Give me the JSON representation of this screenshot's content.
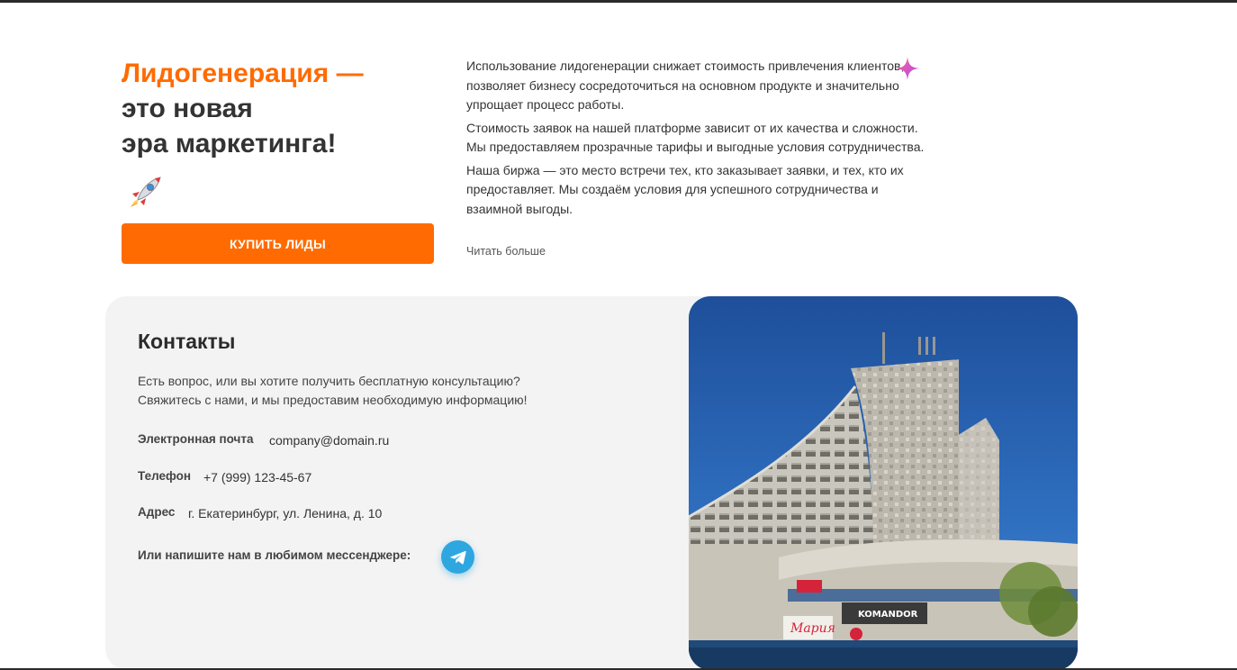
{
  "hero": {
    "title_accent": "Лидогенерация —",
    "title_line2": "это новая",
    "title_line3": "эра маркетинга!",
    "rocket_icon": "rocket-icon",
    "buy_button": "КУПИТЬ ЛИДЫ",
    "paragraphs": [
      "Использование лидогенерации снижает стоимость привлечения клиентов, позволяет бизнесу сосредоточиться на основном продукте и значительно упрощает процесс работы.",
      "Стоимость заявок на нашей платформе зависит от их качества и сложности. Мы предоставляем прозрачные тарифы и выгодные условия сотрудничества.",
      "Наша биржа — это место встречи тех, кто заказывает заявки, и тех, кто их предоставляет. Мы создаём условия для успешного сотрудничества и взаимной выгоды."
    ],
    "read_more": "Читать больше",
    "sparkle_icon": "sparkle-icon"
  },
  "contacts": {
    "title": "Контакты",
    "description_line1": "Есть вопрос, или вы хотите получить бесплатную консультацию?",
    "description_line2": "Свяжитесь с нами, и мы предоставим необходимую информацию!",
    "email_label": "Электронная почта",
    "email_value": "company@domain.ru",
    "phone_label": "Телефон",
    "phone_value": "+7 (999) 123-45-67",
    "address_label": "Адрес",
    "address_value": "г. Екатеринбург, ул. Ленина, д. 10",
    "messenger_label": "Или напишите нам в любимом мессенджере:",
    "telegram_icon": "telegram-icon",
    "photo_signs": [
      "Мария",
      "KOMANDOR"
    ]
  },
  "colors": {
    "accent": "#ff6b00",
    "text": "#333333",
    "card_bg": "#f3f3f3",
    "telegram": "#2ea6e0"
  }
}
